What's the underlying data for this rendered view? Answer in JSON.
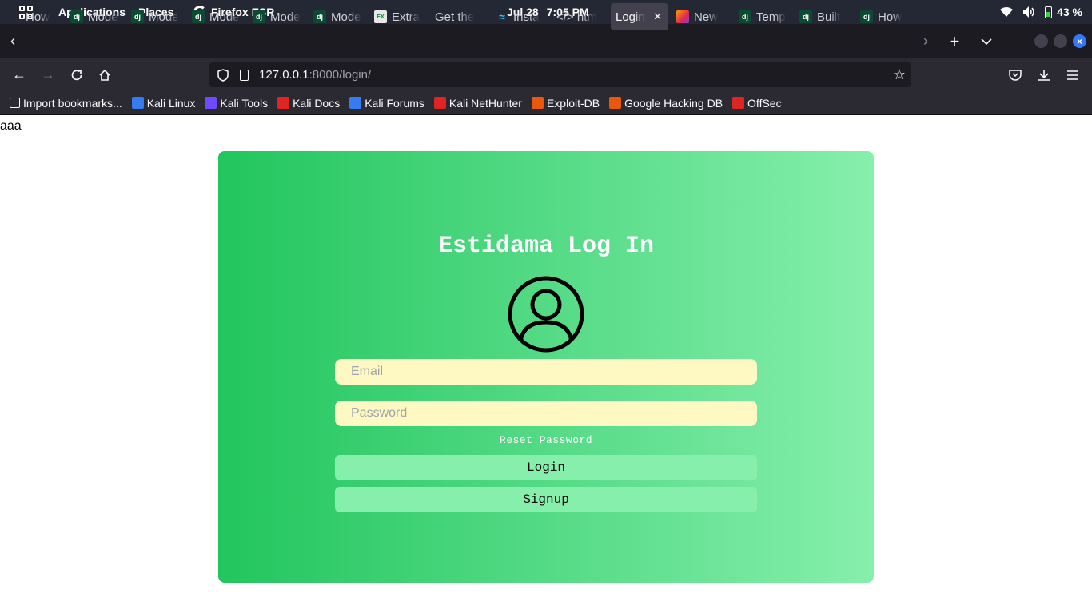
{
  "system": {
    "applications": "Applications",
    "places": "Places",
    "browser": "Firefox ESR",
    "date": "Jul 28",
    "time": "7:05 PM",
    "battery": "43 %"
  },
  "tabs": [
    {
      "label": "How",
      "icon": "none"
    },
    {
      "label": "Mode",
      "icon": "django-icon"
    },
    {
      "label": "Mode",
      "icon": "django-icon"
    },
    {
      "label": "Mode",
      "icon": "django-icon"
    },
    {
      "label": "Mode",
      "icon": "django-icon"
    },
    {
      "label": "Mode",
      "icon": "django-icon"
    },
    {
      "label": "Extra",
      "icon": "excel-icon"
    },
    {
      "label": "Get the",
      "icon": "none"
    },
    {
      "label": "Insta",
      "icon": "tailwind-icon"
    },
    {
      "label": "</> htm",
      "icon": "none"
    },
    {
      "label": "Login",
      "icon": "none",
      "active": true
    },
    {
      "label": "New",
      "icon": "firefox-icon"
    },
    {
      "label": "Temp",
      "icon": "django-icon"
    },
    {
      "label": "Built",
      "icon": "django-icon"
    },
    {
      "label": "How",
      "icon": "django-icon"
    }
  ],
  "url": {
    "host": "127.0.0.1",
    "rest": ":8000/login/"
  },
  "bookmarks": [
    {
      "label": "Import bookmarks...",
      "icon": "import-icon",
      "color": "#fbfbfe"
    },
    {
      "label": "Kali Linux",
      "icon": "kali-dragon-icon",
      "color": "#367bf0"
    },
    {
      "label": "Kali Tools",
      "icon": "kali-tools-icon",
      "color": "#6d4aff"
    },
    {
      "label": "Kali Docs",
      "icon": "kali-docs-icon",
      "color": "#e02424"
    },
    {
      "label": "Kali Forums",
      "icon": "kali-forums-icon",
      "color": "#367bf0"
    },
    {
      "label": "Kali NetHunter",
      "icon": "nethunter-icon",
      "color": "#e02424"
    },
    {
      "label": "Exploit-DB",
      "icon": "exploitdb-icon",
      "color": "#ea580c"
    },
    {
      "label": "Google Hacking DB",
      "icon": "ghdb-icon",
      "color": "#ea580c"
    },
    {
      "label": "OffSec",
      "icon": "offsec-icon",
      "color": "#dc2626"
    }
  ],
  "page": {
    "stray_text": "aaa",
    "title": "Estidama Log In",
    "email_placeholder": "Email",
    "password_placeholder": "Password",
    "reset_label": "Reset Password",
    "login_label": "Login",
    "signup_label": "Signup"
  }
}
